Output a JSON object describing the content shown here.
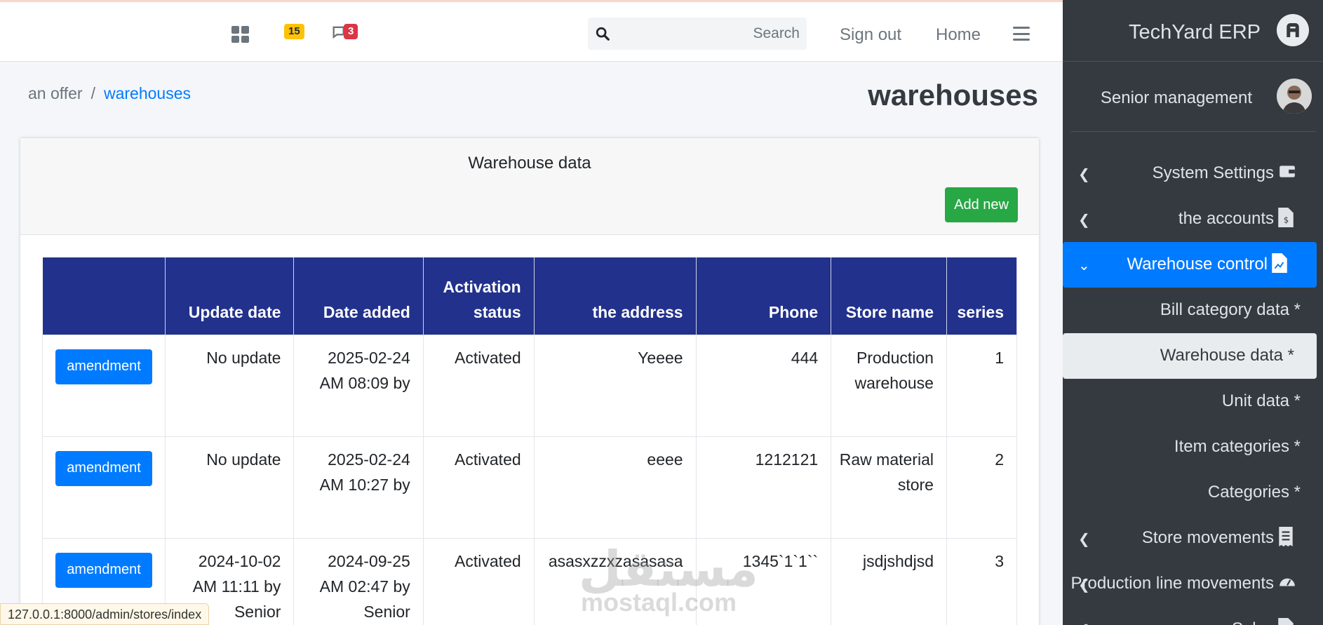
{
  "topbar": {
    "notifications_count": "15",
    "messages_count": "3",
    "search_placeholder": "Search",
    "signout_label": "Sign out",
    "home_label": "Home"
  },
  "breadcrumb": {
    "parent": "an offer",
    "separator": "/",
    "current": "warehouses"
  },
  "page_title": "warehouses",
  "card": {
    "title": "Warehouse data",
    "add_label": "Add new"
  },
  "table": {
    "headers": [
      "",
      "Update date",
      "Date added",
      "Activation status",
      "the address",
      "Phone",
      "Store name",
      "series"
    ],
    "rows": [
      {
        "action": "amendment",
        "update_date": "No update",
        "date_added": "2025-02-24 AM 08:09 by",
        "status": "Activated",
        "address": "Yeeee",
        "phone": "444",
        "store_name": "Production warehouse",
        "series": "1"
      },
      {
        "action": "amendment",
        "update_date": "No update",
        "date_added": "2025-02-24 AM 10:27 by",
        "status": "Activated",
        "address": "eeee",
        "phone": "1212121",
        "store_name": "Raw material store",
        "series": "2"
      },
      {
        "action": "amendment",
        "update_date": "2024-10-02 AM 11:11 by Senior",
        "date_added": "2024-09-25 AM 02:47 by Senior",
        "status": "Activated",
        "address": "asasxzzxzasasasa",
        "phone": "1345`1`1``",
        "store_name": "jsdjshdjsd",
        "series": "3"
      }
    ]
  },
  "sidebar": {
    "brand": "TechYard ERP",
    "user": "Senior management",
    "items": [
      {
        "label": "System Settings"
      },
      {
        "label": "the accounts"
      },
      {
        "label": "Warehouse control"
      },
      {
        "label": "Bill category data *"
      },
      {
        "label": "Warehouse data *"
      },
      {
        "label": "Unit data *"
      },
      {
        "label": "Item categories *"
      },
      {
        "label": "Categories *"
      },
      {
        "label": "Store movements"
      },
      {
        "label": "Production line movements"
      },
      {
        "label": "Sales"
      }
    ]
  },
  "status_url": "127.0.0.1:8000/admin/stores/index",
  "watermark": {
    "arabic": "مستقل",
    "latin": "mostaql.com"
  }
}
